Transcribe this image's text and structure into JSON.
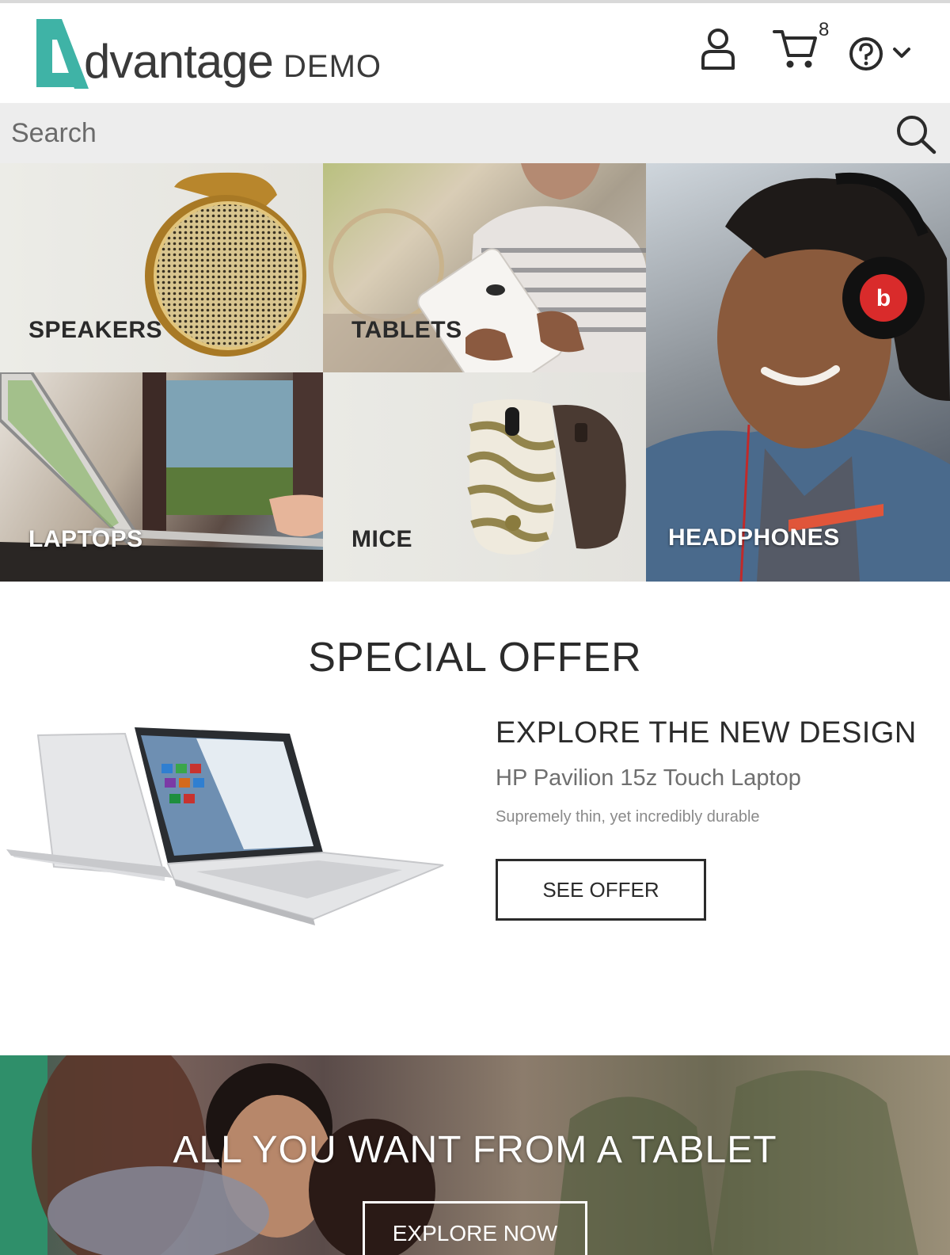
{
  "header": {
    "logo_word": "dvantage",
    "logo_demo": "DEMO",
    "cart_count": "8"
  },
  "search": {
    "placeholder": "Search"
  },
  "categories": [
    {
      "label": "SPEAKERS"
    },
    {
      "label": "TABLETS"
    },
    {
      "label": "HEADPHONES"
    },
    {
      "label": "LAPTOPS"
    },
    {
      "label": "MICE"
    }
  ],
  "special_offer": {
    "title": "SPECIAL OFFER",
    "headline": "EXPLORE THE NEW DESIGN",
    "product": "HP Pavilion 15z Touch Laptop",
    "description": "Supremely thin, yet incredibly durable",
    "button": "SEE OFFER"
  },
  "banner": {
    "title": "ALL YOU WANT FROM A TABLET",
    "button": "EXPLORE NOW"
  },
  "colors": {
    "brand_teal": "#3fb3a6",
    "text_dark": "#2b2b2b"
  }
}
